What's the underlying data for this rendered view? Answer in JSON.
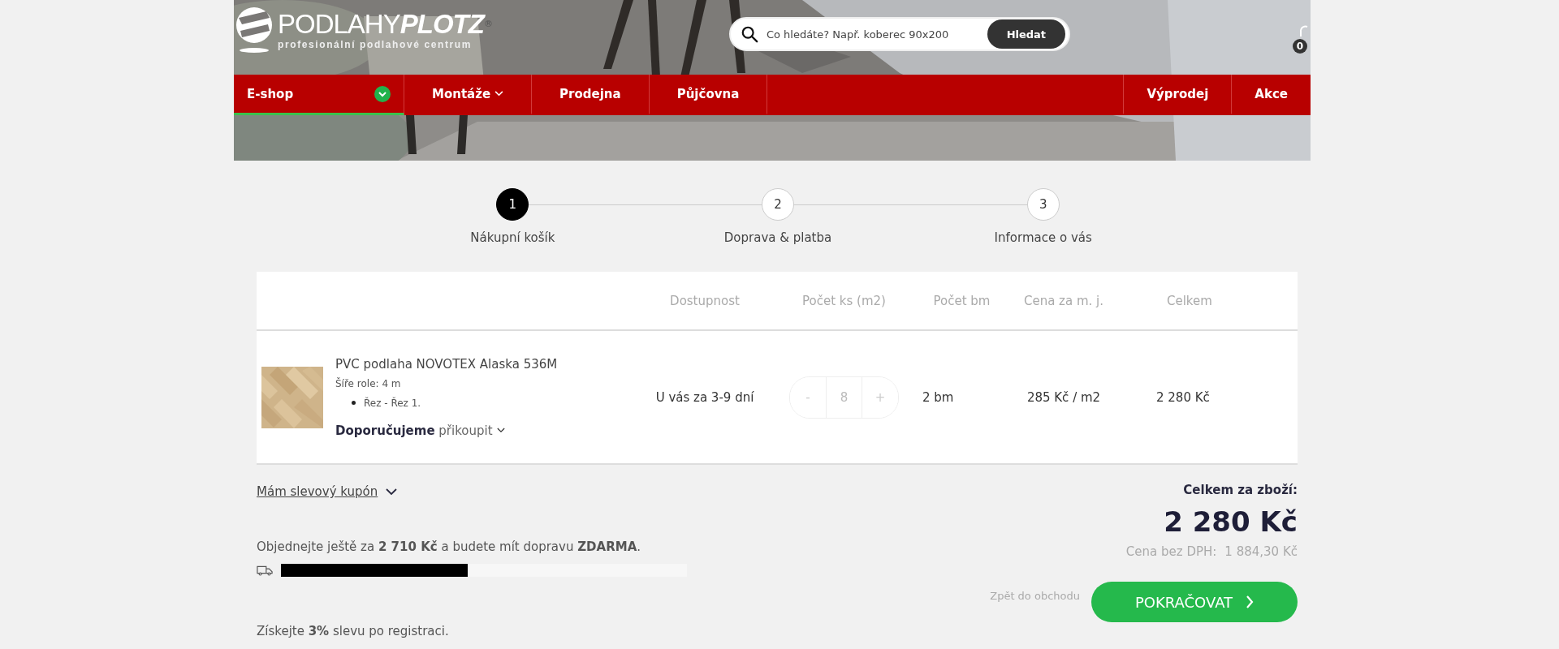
{
  "header": {
    "logo": {
      "name_light": "PODLAHY",
      "name_bold": "PLOTZ",
      "registered": "®",
      "tagline": "profesionální podlahové centrum"
    },
    "search": {
      "placeholder": "Co hledáte? Např. koberec 90x200",
      "button": "Hledat"
    },
    "cart": {
      "count": "0"
    },
    "background": {
      "kind": "picture"
    }
  },
  "nav": {
    "left_items": [
      {
        "label": "E-shop",
        "selected": true,
        "kind": "badge-dropdown"
      },
      {
        "label": "Montáže",
        "selected": false,
        "kind": "dropdown"
      },
      {
        "label": "Prodejna",
        "selected": false,
        "kind": "plain"
      },
      {
        "label": "Půjčovna",
        "selected": false,
        "kind": "plain"
      }
    ],
    "right_items": [
      {
        "label": "Výprodej",
        "selected": false
      },
      {
        "label": "Akce",
        "selected": false
      }
    ]
  },
  "steps": [
    {
      "number": "1",
      "label": "Nákupní košík",
      "selected": true
    },
    {
      "number": "2",
      "label": "Doprava & platba",
      "selected": false
    },
    {
      "number": "3",
      "label": "Informace o vás",
      "selected": false
    }
  ],
  "cart_table": {
    "columns": [
      "Dostupnost",
      "Počet ks (m2)",
      "Počet bm",
      "Cena za m. j.",
      "Celkem"
    ],
    "rows": [
      {
        "image": {
          "kind": "picture"
        },
        "name": "PVC podlaha NOVOTEX Alaska 536M",
        "detail": "Šíře role: 4 m",
        "options": [
          "Řez - Řez 1."
        ],
        "recommend": "**Doporučujeme** přikoupit",
        "availability": "U vás za 3-9 dní",
        "quantity": {
          "minus": "-",
          "value": "8",
          "plus": "+"
        },
        "meters": "2 bm",
        "unit_price": "285 Kč / m2",
        "total": "2 280 Kč"
      }
    ]
  },
  "coupon": {
    "label": "Mám slevový kupón"
  },
  "shipping": {
    "text": "Objednejte ještě za **2 710 Kč** a budete mít dopravu **ZDARMA**.",
    "level": 0.46
  },
  "registration": {
    "text": "Získejte **3%** slevu po registraci."
  },
  "summary": {
    "label": "Celkem za zboží:",
    "total": "2 280 Kč",
    "net_label": "Cena bez DPH:",
    "net_value": "1 884,30 Kč"
  },
  "actions": {
    "back": "Zpět do obchodu",
    "continue": "POKRAČOVAT"
  }
}
